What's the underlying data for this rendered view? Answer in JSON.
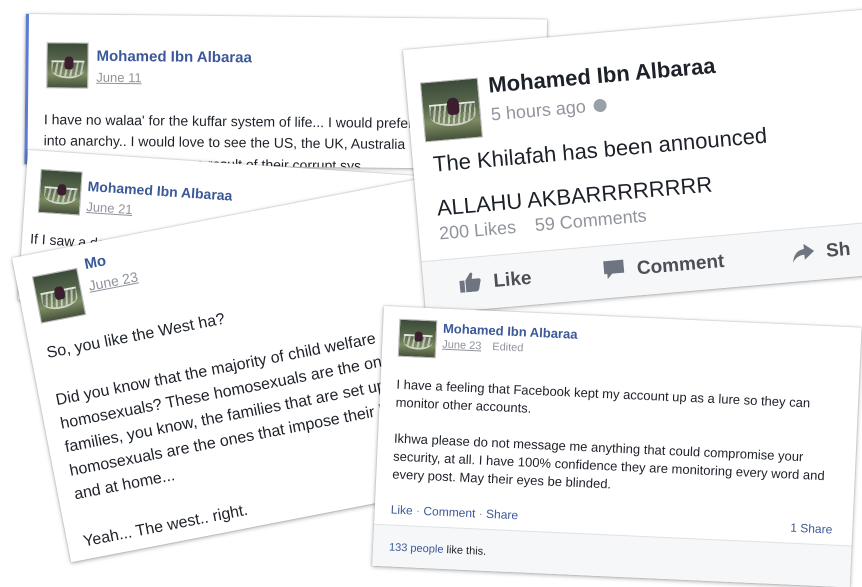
{
  "posts": [
    {
      "author": "Mohamed Ibn Albaraa",
      "date": "June 11",
      "lines": [
        "I have no walaa' for the kuffar system of life... I would prefer",
        "into anarchy.. I would love to see the US, the UK, Australia",
        "as a result of their corrupt sys"
      ]
    },
    {
      "author": "Mohamed Ibn Albaraa",
      "date": "June 21",
      "lines": [
        "If I saw a dog drowning and a Shia drowning, I'd save the dog."
      ]
    },
    {
      "author": "Mo",
      "date": "June 23",
      "lines": [
        "So, you like the West ha?",
        "",
        "Did you know that the majority of child welfare",
        "homosexuals? These homosexuals are the ones that",
        "families, you know, the families that are set up the w",
        "homosexuals are the ones that impose their laws o",
        "and at home...",
        "",
        "Yeah... The west.. right."
      ]
    },
    {
      "author": "Mohamed Ibn Albaraa",
      "time": "5 hours ago",
      "lines": [
        "The Khilafah has been announced",
        "",
        "ALLAHU AKBARRRRRRRR"
      ],
      "stats": {
        "likes": "200 Likes",
        "comments": "59 Comments"
      },
      "actions": {
        "like": "Like",
        "comment": "Comment",
        "share": "Sh"
      }
    },
    {
      "author": "Mohamed Ibn Albaraa",
      "date": "June 23",
      "edited": "Edited",
      "lines": [
        "I have a feeling that Facebook kept my account up as a lure so they can",
        "monitor other accounts.",
        "",
        "Ikhwa please do not message me anything that could compromise your",
        "security, at all. I have 100% confidence they are monitoring every word and",
        "every post. May their eyes be blinded."
      ],
      "actions": {
        "like": "Like",
        "comment": "Comment",
        "share": "Share",
        "sep": "·"
      },
      "shares": "1 Share",
      "likes_count": "133 people",
      "likes_suffix": "like this."
    }
  ],
  "colors": {
    "link": "#3b5998",
    "text": "#1d2129",
    "muted": "#90949c",
    "panel": "#f6f7f9"
  }
}
